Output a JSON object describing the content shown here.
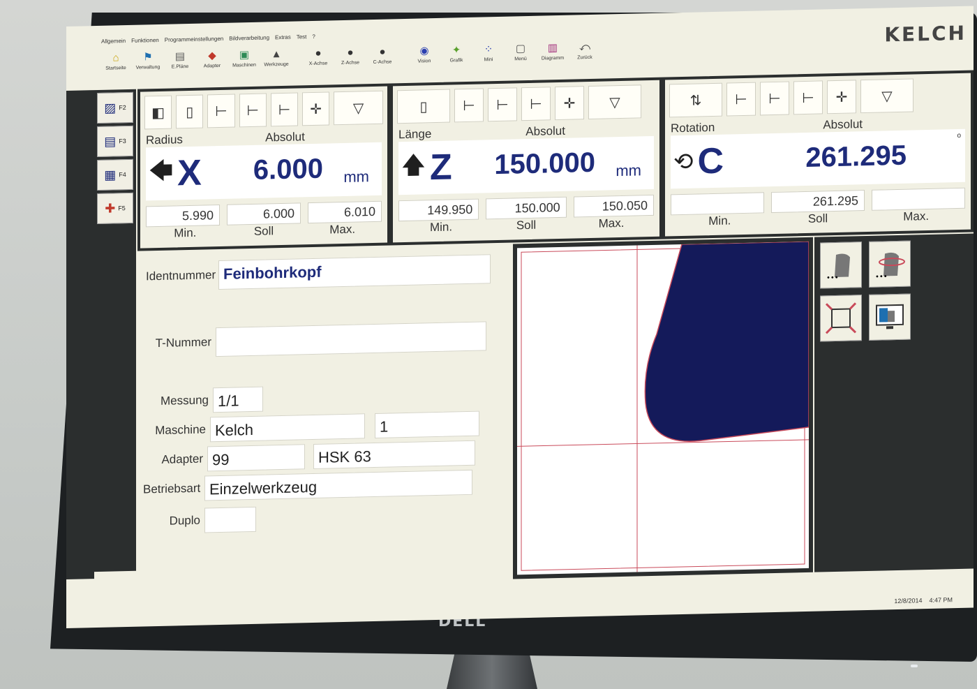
{
  "menu": [
    "Allgemein",
    "Funktionen",
    "Programmeinstellungen",
    "Bildverarbeitung",
    "Extras",
    "Test",
    "?"
  ],
  "toolbar": [
    {
      "icon": "home-icon",
      "glyph": "⌂",
      "label": "Startseite"
    },
    {
      "icon": "flag-icon",
      "glyph": "⚑",
      "label": "Verwaltung"
    },
    {
      "icon": "doc-icon",
      "glyph": "▤",
      "label": "E.Pläne"
    },
    {
      "icon": "adapter-icon",
      "glyph": "◆",
      "label": "Adapter"
    },
    {
      "icon": "machine-icon",
      "glyph": "▣",
      "label": "Maschinen"
    },
    {
      "icon": "tool-icon",
      "glyph": "▲",
      "label": "Werkzeuge"
    },
    {
      "icon": "x-axis-icon",
      "glyph": "●",
      "label": "X-Achse"
    },
    {
      "icon": "z-axis-icon",
      "glyph": "●",
      "label": "Z-Achse"
    },
    {
      "icon": "c-axis-icon",
      "glyph": "●",
      "label": "C-Achse"
    },
    {
      "icon": "vision-icon",
      "glyph": "◉",
      "label": "Vision"
    },
    {
      "icon": "graphic-icon",
      "glyph": "✦",
      "label": "Grafik"
    },
    {
      "icon": "mini-icon",
      "glyph": "⁘",
      "label": "Mini"
    },
    {
      "icon": "menu-icon",
      "glyph": "▢",
      "label": "Menü"
    },
    {
      "icon": "diagram-icon",
      "glyph": "▥",
      "label": "Diagramm"
    },
    {
      "icon": "back-icon",
      "glyph": "⤺",
      "label": "Zurück"
    }
  ],
  "brand": "KELCH",
  "fkeys": [
    {
      "icon": "measure-icon",
      "glyph": "▨",
      "key": "F2"
    },
    {
      "icon": "label-icon",
      "glyph": "▤",
      "key": "F3"
    },
    {
      "icon": "protocol-icon",
      "glyph": "▦",
      "key": "F4"
    },
    {
      "icon": "zero-point-icon",
      "glyph": "✚",
      "key": "F5"
    }
  ],
  "axes": [
    {
      "name": "Radius",
      "mode": "Absolut",
      "arrow": "🡄",
      "letter": "X",
      "value": "6.000",
      "unit": "mm",
      "min": "5.990",
      "soll": "6.000",
      "max": "6.010"
    },
    {
      "name": "Länge",
      "mode": "Absolut",
      "arrow": "🡅",
      "letter": "Z",
      "value": "150.000",
      "unit": "mm",
      "min": "149.950",
      "soll": "150.000",
      "max": "150.050"
    },
    {
      "name": "Rotation",
      "mode": "Absolut",
      "arrow": "⟲",
      "letter": "C",
      "value": "261.295",
      "unit": "",
      "min": "",
      "soll": "261.295",
      "max": ""
    }
  ],
  "limit_labels": {
    "min": "Min.",
    "soll": "Soll",
    "max": "Max."
  },
  "form": {
    "ident_label": "Identnummer",
    "ident_value": "Feinbohrkopf",
    "tnum_label": "T-Nummer",
    "tnum_value": "",
    "messung_label": "Messung",
    "messung_value": "1/1",
    "maschine_label": "Maschine",
    "maschine_value": "Kelch",
    "maschine_num": "1",
    "adapter_label": "Adapter",
    "adapter_value": "99",
    "adapter_type": "HSK 63",
    "betrieb_label": "Betriebsart",
    "betrieb_value": "Einzelwerkzeug",
    "duplo_label": "Duplo",
    "duplo_value": ""
  },
  "status": {
    "date": "12/8/2014",
    "time": "4:47 PM"
  },
  "colors": {
    "value_blue": "#1e2b7a",
    "tool_fill": "#141a5a",
    "crosshair": "#c94a5a"
  }
}
